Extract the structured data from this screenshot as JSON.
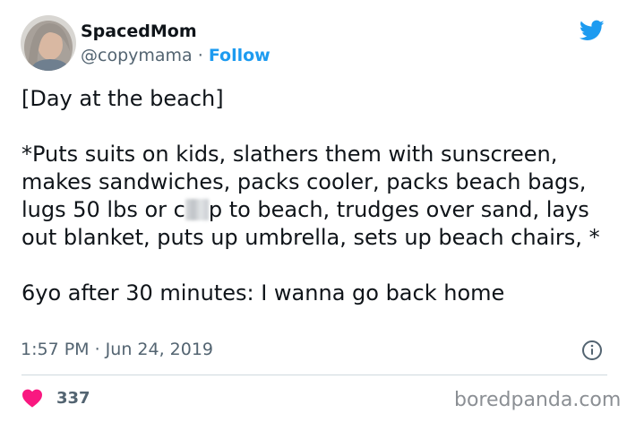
{
  "tweet": {
    "author": {
      "name": "SpacedMom",
      "handle": "@copymama",
      "separator": " · ",
      "follow_label": "Follow"
    },
    "text": {
      "line_1": "[Day at the beach]",
      "line_2_before": "*Puts suits on kids, slathers them with sunscreen, makes sandwiches, packs cooler, packs beach bags, lugs 50 lbs or c",
      "line_2_after": "p to beach, trudges over sand, lays out blanket, puts up umbrella, sets up beach chairs, *",
      "line_3": "6yo after 30 minutes: I wanna go back home"
    },
    "timestamp": "1:57 PM · Jun 24, 2019",
    "likes": "337"
  },
  "watermark": "boredpanda.com",
  "icons": {
    "logo": "twitter-bird-icon",
    "info": "info-icon",
    "like": "heart-icon"
  },
  "colors": {
    "accent": "#1d9bf0",
    "like": "#f91880",
    "secondary_text": "#536471"
  }
}
